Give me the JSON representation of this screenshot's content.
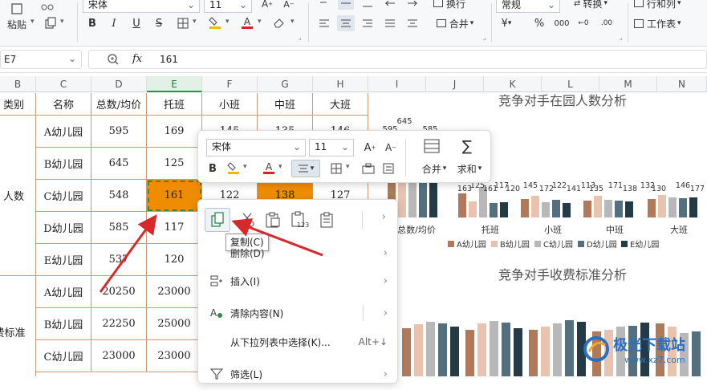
{
  "ribbon": {
    "paste_label": "粘贴",
    "font_name": "宋体",
    "font_size": "11",
    "wrap_label": "换行",
    "merge_label": "合并",
    "number_format": "常规",
    "convert_label": "转换",
    "rowcol_label": "行和列",
    "worksheet_label": "工作表",
    "currency_symbol": "¥",
    "percent_symbol": "%"
  },
  "formula_bar": {
    "cell_ref": "E7",
    "fx": "fx",
    "value": "161"
  },
  "columns": [
    "B",
    "C",
    "D",
    "E",
    "F",
    "G",
    "H",
    "I",
    "J",
    "K",
    "L",
    "M",
    "N"
  ],
  "table": {
    "headers": [
      "类别",
      "名称",
      "总数/均价",
      "托班",
      "小班",
      "中班",
      "大班"
    ],
    "rows": [
      {
        "cat": "",
        "name": "A幼儿园",
        "total": "595",
        "tuo": "169",
        "xiao": "145",
        "zhong": "135",
        "da": "146"
      },
      {
        "cat": "",
        "name": "B幼儿园",
        "total": "645",
        "tuo": "125",
        "xiao": "",
        "zhong": "",
        "da": ""
      },
      {
        "cat": "人数",
        "name": "C幼儿园",
        "total": "548",
        "tuo": "161",
        "xiao": "122",
        "zhong": "138",
        "da": "127"
      },
      {
        "cat": "",
        "name": "D幼儿园",
        "total": "585",
        "tuo": "117",
        "xiao": "",
        "zhong": "",
        "da": ""
      },
      {
        "cat": "",
        "name": "E幼儿园",
        "total": "537",
        "tuo": "120",
        "xiao": "",
        "zhong": "",
        "da": ""
      },
      {
        "cat": "",
        "name": "A幼儿园",
        "total": "20250",
        "tuo": "23000",
        "xiao": "",
        "zhong": "",
        "da": ""
      },
      {
        "cat": "",
        "name": "B幼儿园",
        "total": "22250",
        "tuo": "25000",
        "xiao": "",
        "zhong": "",
        "da": ""
      },
      {
        "cat": "费标准",
        "name": "C幼儿园",
        "total": "23000",
        "tuo": "23000",
        "xiao": "",
        "zhong": "",
        "da": ""
      }
    ]
  },
  "float_toolbar": {
    "font_name": "宋体",
    "font_size": "11",
    "merge_label": "合并",
    "sum_label": "求和"
  },
  "context_menu": {
    "tooltip": "复制(C)",
    "delete_label": "删除(D)",
    "insert_label": "插入(I)",
    "clear_label": "清除内容(N)",
    "pick_label": "从下拉列表中选择(K)...",
    "pick_shortcut": "Alt+↓",
    "filter_label": "筛选(L)"
  },
  "chart1": {
    "title": "竞争对手在园人数分析",
    "top_labels": [
      "595",
      "645",
      "585"
    ],
    "categories": [
      "总数/均价",
      "托班",
      "小班",
      "中班",
      "大班"
    ],
    "group_labels": [
      "163",
      "125",
      "161",
      "117",
      "120",
      "145",
      "172",
      "122",
      "141",
      "113",
      "135",
      "171",
      "138",
      "132",
      "130",
      "146",
      "177"
    ],
    "legend": [
      "A幼儿园",
      "B幼儿园",
      "C幼儿园",
      "D幼儿园",
      "E幼儿园"
    ],
    "colors": [
      "#b07a5a",
      "#e9c3b0",
      "#b8b8b8",
      "#54707e",
      "#233a47"
    ]
  },
  "chart2": {
    "title": "竞争对手收费标准分析"
  },
  "watermark": {
    "text": "极光下载站",
    "url": "www.xz7.com"
  }
}
